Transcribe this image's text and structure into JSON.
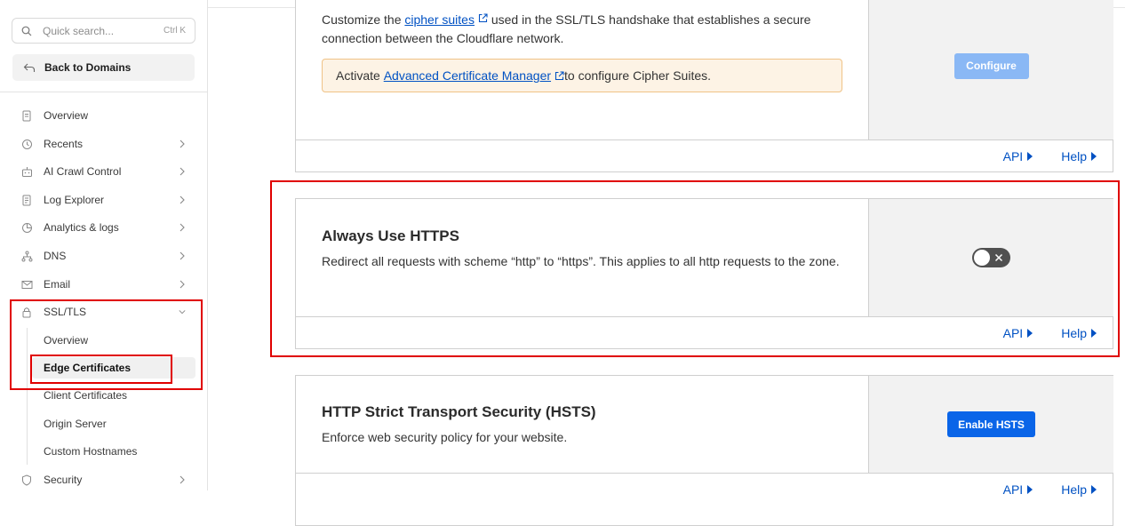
{
  "sidebar": {
    "search_placeholder": "Quick search...",
    "search_shortcut": "Ctrl K",
    "back_label": "Back to Domains",
    "items": [
      {
        "label": "Overview",
        "icon": "document-icon"
      },
      {
        "label": "Recents",
        "icon": "clock-icon"
      },
      {
        "label": "AI Crawl Control",
        "icon": "robot-icon"
      },
      {
        "label": "Log Explorer",
        "icon": "log-icon"
      },
      {
        "label": "Analytics & logs",
        "icon": "chart-pie-icon"
      },
      {
        "label": "DNS",
        "icon": "network-icon"
      },
      {
        "label": "Email",
        "icon": "mail-icon"
      },
      {
        "label": "SSL/TLS",
        "icon": "lock-icon"
      },
      {
        "label": "Security",
        "icon": "shield-icon"
      }
    ],
    "ssl_sub": [
      {
        "label": "Overview"
      },
      {
        "label": "Edge Certificates"
      },
      {
        "label": "Client Certificates"
      },
      {
        "label": "Origin Server"
      },
      {
        "label": "Custom Hostnames"
      }
    ]
  },
  "cipher_card": {
    "desc_before": "Customize the ",
    "link": "cipher suites",
    "desc_after": " used in the SSL/TLS handshake that establishes a secure connection between the Cloudflare network.",
    "desc_after_exact": " used in the SSL/TLS handshake that establishes a secure connection between the Cloudflare network.",
    "notice_before": "Activate ",
    "notice_link": "Advanced Certificate Manager",
    "notice_after": " to configure Cipher Suites.",
    "button": "Configure",
    "api": "API",
    "help": "Help"
  },
  "https_card": {
    "title": "Always Use HTTPS",
    "desc": "Redirect all requests with scheme “http” to “https”. This applies to all http requests to the zone.",
    "toggle_on": false,
    "api": "API",
    "help": "Help"
  },
  "hsts_card": {
    "title": "HTTP Strict Transport Security (HSTS)",
    "desc": "Enforce web security policy for your website.",
    "button": "Enable HSTS",
    "api": "API",
    "help": "Help"
  },
  "colors": {
    "link": "#0051c3",
    "primary_button": "#0a65e8",
    "disabled_button": "#8ab8f5",
    "highlight": "#e00000",
    "notice_bg": "#fdf3e5"
  }
}
